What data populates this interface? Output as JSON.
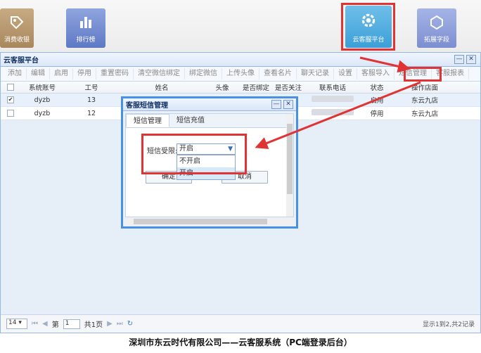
{
  "launchers": {
    "cash": "消费收银",
    "rank": "排行榜",
    "cloud": "云客服平台",
    "expand": "拓展字段"
  },
  "window": {
    "title": "云客服平台",
    "toolbar": [
      "添加",
      "编辑",
      "启用",
      "停用",
      "重置密码",
      "清空微信绑定",
      "绑定微信",
      "上传头像",
      "查看名片",
      "聊天记录",
      "设置",
      "客服导入",
      "短信管理",
      "客服报表"
    ]
  },
  "grid": {
    "headers": [
      "系统账号",
      "工号",
      "姓名",
      "头像",
      "是否绑定",
      "是否关注",
      "联系电话",
      "状态",
      "操作店面"
    ],
    "rows": [
      {
        "account": "dyzb",
        "no": "13",
        "status": "启用",
        "store": "东云九店"
      },
      {
        "account": "dyzb",
        "no": "12",
        "status": "停用",
        "store": "东云九店"
      }
    ]
  },
  "pager": {
    "page_size": "14",
    "page_prefix": "第",
    "page_value": "1",
    "page_suffix": "共1页",
    "info": "显示1到2,共2记录"
  },
  "dialog": {
    "title": "客服短信管理",
    "tabs": [
      "短信管理",
      "短信充值"
    ],
    "label": "短信受限:",
    "selected": "开启",
    "options": [
      "不开启",
      "开启"
    ],
    "confirm": "确定",
    "cancel": "取消"
  },
  "caption": "深圳市东云时代有限公司——云客服系统（PC端登录后台）"
}
